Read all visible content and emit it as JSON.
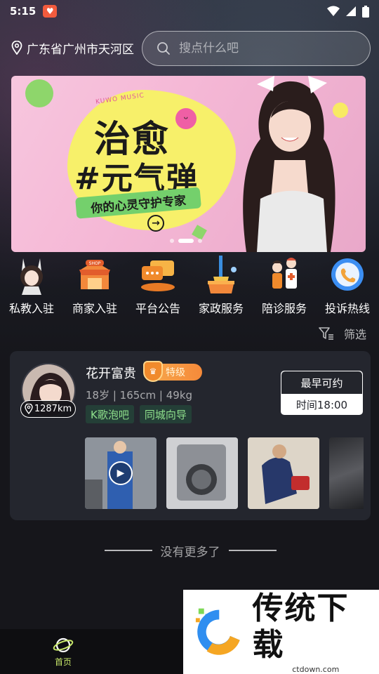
{
  "status_bar": {
    "time": "5:15"
  },
  "header": {
    "location": "广东省广州市天河区",
    "search_placeholder": "搜点什么吧"
  },
  "banner": {
    "brand": "KUWO MUSIC",
    "title_line1": "治愈",
    "title_line2": "#元气弹",
    "subtitle": "你的心灵守护专家",
    "slide_count": 3,
    "active_slide": 2
  },
  "categories": [
    {
      "label": "私教入驻",
      "icon": "rabbit-girl-icon"
    },
    {
      "label": "商家入驻",
      "icon": "shop-icon"
    },
    {
      "label": "平台公告",
      "icon": "announcement-icon"
    },
    {
      "label": "家政服务",
      "icon": "cleaning-icon"
    },
    {
      "label": "陪诊服务",
      "icon": "medical-escort-icon"
    },
    {
      "label": "投诉热线",
      "icon": "hotline-icon"
    }
  ],
  "filter": {
    "label": "筛选"
  },
  "profile_card": {
    "name": "花开富贵",
    "badge": "特级",
    "distance": "1287km",
    "stats": "18岁 | 165cm | 49kg",
    "tags": [
      "K歌泡吧",
      "同城向导"
    ],
    "availability": {
      "title": "最早可约",
      "time": "时间18:00"
    }
  },
  "list_end_text": "没有更多了",
  "bottom_nav": {
    "home_label": "首页"
  },
  "watermark": {
    "title": "传统下载",
    "url": "ctdown.com"
  },
  "colors": {
    "accent_green": "#8fe08c",
    "badge_orange": "#f58a3a",
    "nav_active": "#c8e86a"
  }
}
